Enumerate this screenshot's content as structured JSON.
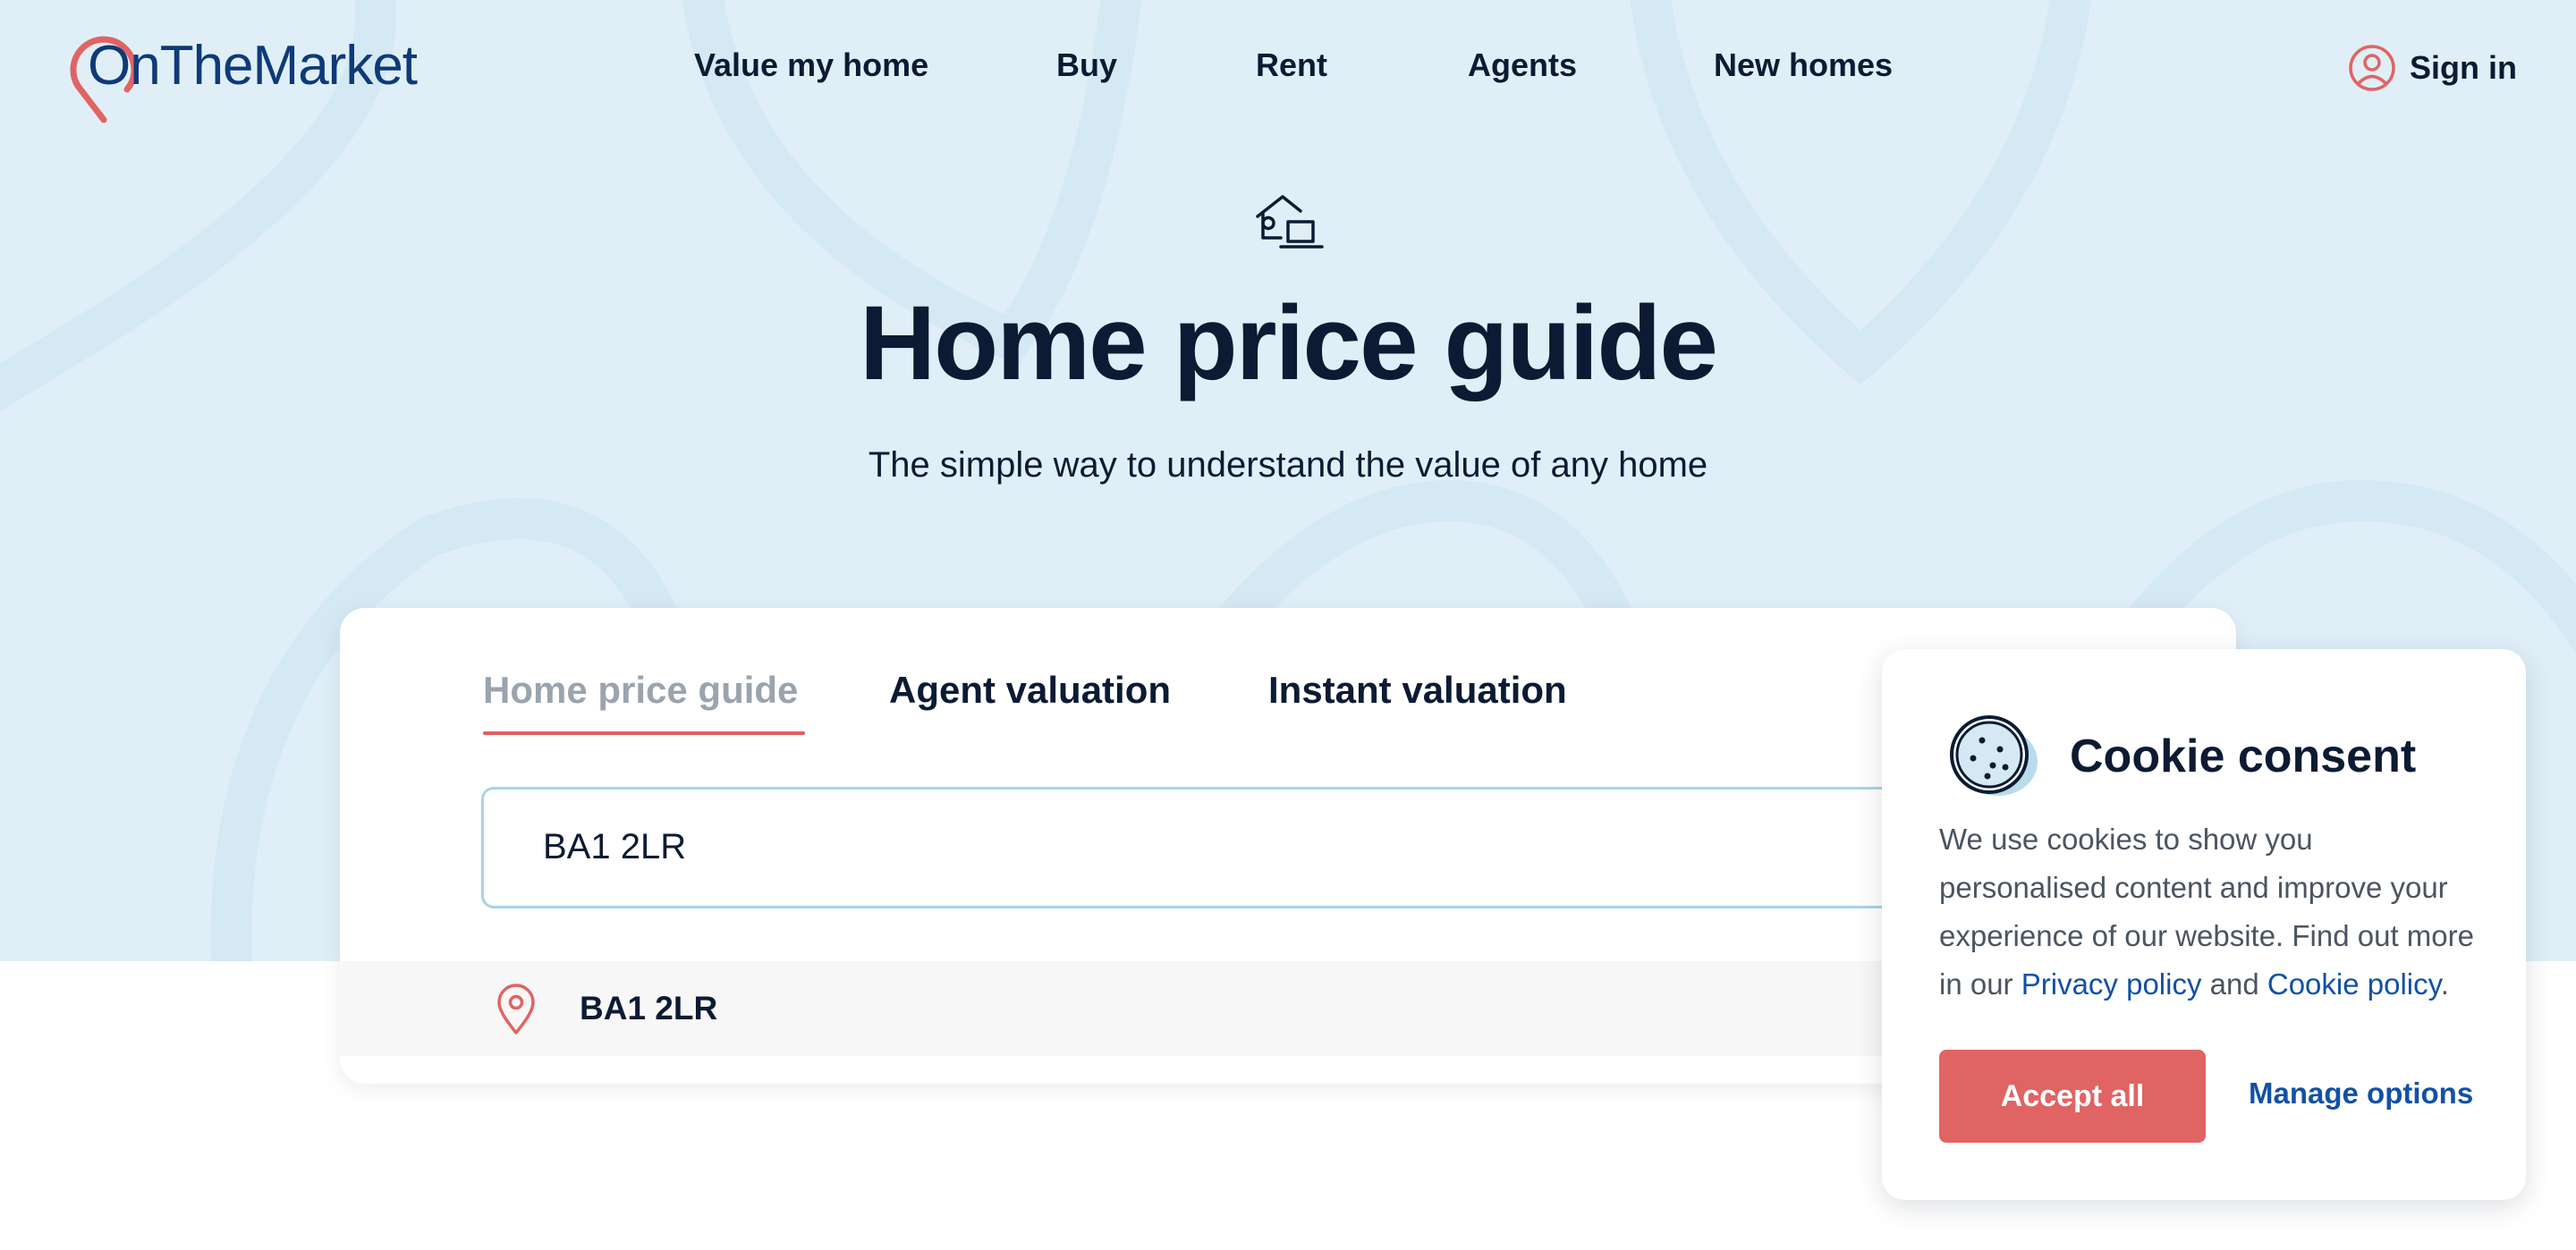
{
  "header": {
    "logo_text": "OnTheMarket",
    "nav": [
      "Value my home",
      "Buy",
      "Rent",
      "Agents",
      "New homes"
    ],
    "sign_in": "Sign in"
  },
  "hero": {
    "title": "Home price guide",
    "subtitle": "The simple way to understand the value of any home"
  },
  "search_card": {
    "tabs": [
      {
        "label": "Home price guide",
        "active": true
      },
      {
        "label": "Agent valuation",
        "active": false
      },
      {
        "label": "Instant valuation",
        "active": false
      }
    ],
    "input_value": "BA1 2LR",
    "suggestion": "BA1 2LR"
  },
  "cookie": {
    "title": "Cookie consent",
    "body": "We use cookies to show you personalised content and improve your experience of our website. Find out more in our",
    "privacy_link": "Privacy policy",
    "and_text": "and",
    "cookie_link": "Cookie policy",
    "period": ".",
    "accept_label": "Accept all",
    "manage_label": "Manage options"
  },
  "colors": {
    "brand_navy": "#0e3a78",
    "accent_red": "#e06464",
    "hero_bg": "#e0eff7",
    "link_blue": "#1251a6"
  },
  "icons": [
    "map-pin-logo-icon",
    "user-circle-icon",
    "house-laptop-icon",
    "location-pin-icon",
    "cookie-icon"
  ]
}
